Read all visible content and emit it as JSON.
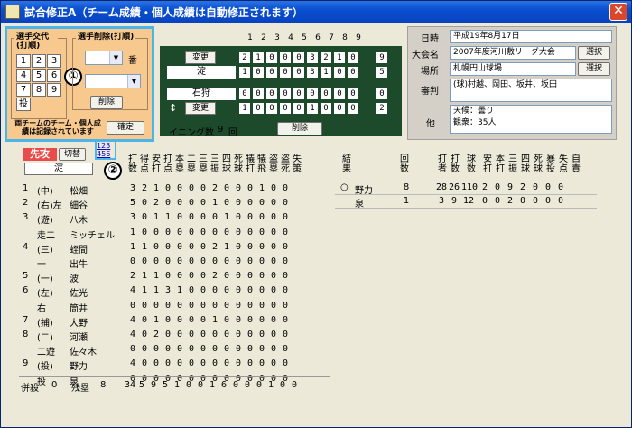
{
  "window": {
    "title": "試合修正A（チーム成績・個人成績は自動修正されます）",
    "close_glyph": "✕"
  },
  "subs_panel": {
    "section_title": "選手交代(打順)",
    "keys": [
      "1",
      "2",
      "3",
      "4",
      "5",
      "6",
      "7",
      "8",
      "9",
      "投"
    ],
    "delete_section_title": "選手削除(打順)",
    "ban_label": "番",
    "delete_button": "削除",
    "note": "両チームのチーム・個人成績は記録されています",
    "confirm_button": "確定",
    "marker_one": "①"
  },
  "scoreboard": {
    "innings": [
      "1",
      "2",
      "3",
      "4",
      "5",
      "6",
      "7",
      "8",
      "9"
    ],
    "top_team": {
      "change_button": "変更",
      "name": "淀",
      "scores": [
        "2",
        "1",
        "0",
        "0",
        "0",
        "3",
        "2",
        "1",
        "0"
      ],
      "total": "9"
    },
    "top_team_row2": {
      "scores": [
        "1",
        "0",
        "0",
        "0",
        "0",
        "3",
        "1",
        "0",
        "0"
      ],
      "total": "5"
    },
    "bottom_team": {
      "name": "石狩",
      "scores": [
        "0",
        "0",
        "0",
        "0",
        "0",
        "0",
        "0",
        "0",
        "0"
      ],
      "total": "0"
    },
    "bottom_team_row2": {
      "swap_glyph": "↕",
      "change_button": "変更",
      "scores": [
        "1",
        "0",
        "0",
        "0",
        "0",
        "1",
        "0",
        "0",
        "0"
      ],
      "total": "2"
    },
    "innings_label": "イニング数",
    "innings_count": "9",
    "innings_unit": "回",
    "delete_button": "削除"
  },
  "info": {
    "date_label": "日時",
    "date_value": "平成19年8月17日",
    "tournament_label": "大会名",
    "tournament_value": "2007年度河川敷リーグ大会",
    "select1": "選択",
    "place_label": "場所",
    "place_value": "札幌円山球場",
    "select2": "選択",
    "umpire_label": "審判",
    "umpire_value": "(球)村越、岡田、坂井、坂田",
    "other_label": "他",
    "other_line1": "天候：曇り",
    "other_line2": "観衆：35人"
  },
  "batting": {
    "senko_label": "先攻",
    "switch_button": "切替",
    "team_name": "淀",
    "page_links": [
      "1",
      "2",
      "3",
      "4",
      "5",
      "6"
    ],
    "marker_two": "②",
    "headers": [
      "打数",
      "得点",
      "安打",
      "打点",
      "本塁",
      "二塁",
      "三塁",
      "三振",
      "四球",
      "死球",
      "犠打",
      "犠飛",
      "盗塁",
      "盗死",
      "失策"
    ],
    "rows": [
      {
        "order": "1",
        "pos": "(中)",
        "name": "松畑",
        "stats": [
          "3",
          "2",
          "1",
          "0",
          "0",
          "0",
          "0",
          "2",
          "0",
          "0",
          "0",
          "1",
          "0",
          "0"
        ]
      },
      {
        "order": "2",
        "pos": "(右)左",
        "name": "細谷",
        "stats": [
          "5",
          "0",
          "2",
          "0",
          "0",
          "0",
          "0",
          "1",
          "0",
          "0",
          "0",
          "0",
          "0",
          "0"
        ]
      },
      {
        "order": "3",
        "pos": "(遊)",
        "name": "八木",
        "stats": [
          "3",
          "0",
          "1",
          "1",
          "0",
          "0",
          "0",
          "0",
          "1",
          "0",
          "0",
          "0",
          "0",
          "0"
        ]
      },
      {
        "order": "",
        "pos": "走二",
        "name": "ミッチェル",
        "stats": [
          "1",
          "0",
          "0",
          "0",
          "0",
          "0",
          "0",
          "0",
          "0",
          "0",
          "0",
          "0",
          "0",
          "0"
        ]
      },
      {
        "order": "4",
        "pos": "(三)",
        "name": "蛭間",
        "stats": [
          "1",
          "1",
          "0",
          "0",
          "0",
          "0",
          "0",
          "2",
          "1",
          "0",
          "0",
          "0",
          "0",
          "0"
        ]
      },
      {
        "order": "",
        "pos": "一",
        "name": "出牛",
        "stats": [
          "0",
          "0",
          "0",
          "0",
          "0",
          "0",
          "0",
          "0",
          "0",
          "0",
          "0",
          "0",
          "0",
          "0"
        ]
      },
      {
        "order": "5",
        "pos": "(一)",
        "name": "波",
        "stats": [
          "2",
          "1",
          "1",
          "0",
          "0",
          "0",
          "0",
          "2",
          "0",
          "0",
          "0",
          "0",
          "0",
          "0"
        ]
      },
      {
        "order": "6",
        "pos": "(左)",
        "name": "佐光",
        "stats": [
          "4",
          "1",
          "1",
          "3",
          "1",
          "0",
          "0",
          "0",
          "0",
          "0",
          "0",
          "0",
          "0",
          "0"
        ]
      },
      {
        "order": "",
        "pos": "右",
        "name": "筒井",
        "stats": [
          "0",
          "0",
          "0",
          "0",
          "0",
          "0",
          "0",
          "0",
          "0",
          "0",
          "0",
          "0",
          "0",
          "0"
        ]
      },
      {
        "order": "7",
        "pos": "(捕)",
        "name": "大野",
        "stats": [
          "4",
          "0",
          "1",
          "0",
          "0",
          "0",
          "0",
          "1",
          "0",
          "0",
          "0",
          "0",
          "0",
          "0"
        ]
      },
      {
        "order": "8",
        "pos": "(二)",
        "name": "河瀬",
        "stats": [
          "4",
          "0",
          "2",
          "0",
          "0",
          "0",
          "0",
          "0",
          "0",
          "0",
          "0",
          "0",
          "0",
          "0"
        ]
      },
      {
        "order": "",
        "pos": "二遊",
        "name": "佐々木",
        "stats": [
          "0",
          "0",
          "0",
          "0",
          "0",
          "0",
          "0",
          "0",
          "0",
          "0",
          "0",
          "0",
          "0",
          "0"
        ]
      },
      {
        "order": "9",
        "pos": "(投)",
        "name": "野力",
        "stats": [
          "4",
          "0",
          "0",
          "0",
          "0",
          "0",
          "0",
          "0",
          "0",
          "0",
          "0",
          "0",
          "0",
          "0"
        ]
      },
      {
        "order": "",
        "pos": "投",
        "name": "泉",
        "stats": [
          "0",
          "0",
          "0",
          "0",
          "0",
          "0",
          "0",
          "0",
          "0",
          "0",
          "0",
          "0",
          "0",
          "0"
        ]
      }
    ],
    "heiso_label": "併殺",
    "heiso_value": "0",
    "zanrui_label": "残塁",
    "zanrui_value": "8",
    "totals": [
      "34",
      "5",
      "9",
      "5",
      "1",
      "0",
      "0",
      "1",
      "6",
      "0",
      "0",
      "0",
      "1",
      "0",
      "0"
    ]
  },
  "pitching": {
    "headers": [
      "結果",
      "回数",
      "打者",
      "打数",
      "球数",
      "安打",
      "本打",
      "三振",
      "四球",
      "死球",
      "暴投",
      "失点",
      "自責"
    ],
    "rows": [
      {
        "result": "○",
        "name": "野力",
        "innings": "8",
        "stats": [
          "28",
          "26",
          "110",
          "2",
          "0",
          "9",
          "2",
          "0",
          "0",
          "0"
        ]
      },
      {
        "result": "",
        "name": "泉",
        "innings": "1",
        "stats": [
          "3",
          "9",
          "12",
          "0",
          "0",
          "2",
          "0",
          "0",
          "0",
          "0"
        ]
      }
    ]
  }
}
